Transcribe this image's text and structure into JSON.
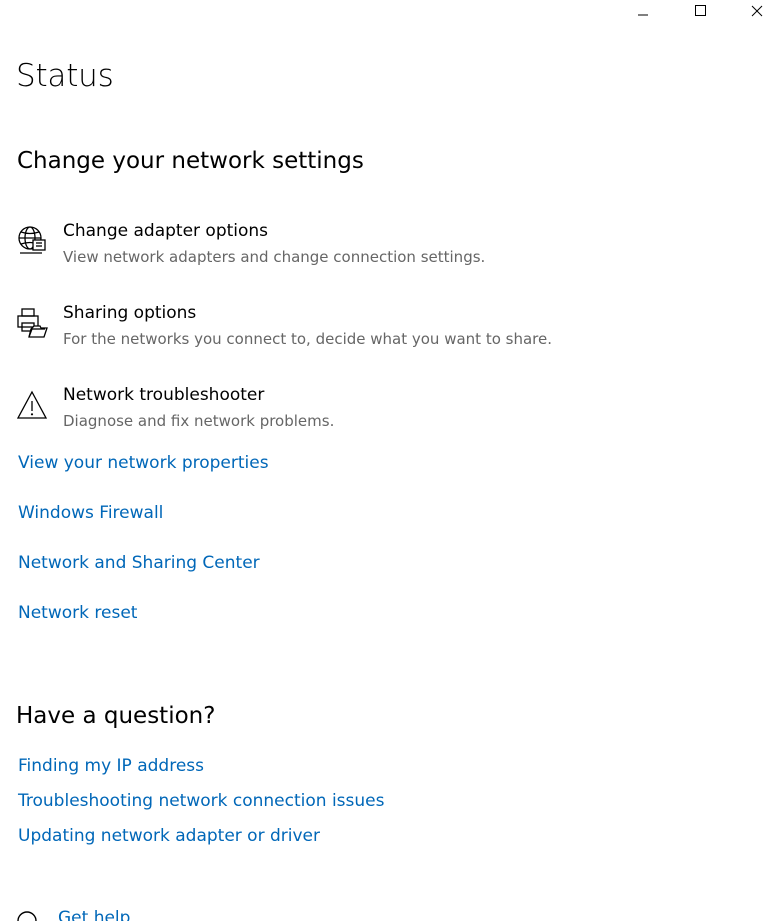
{
  "titlebar": {
    "minimize_icon": "minimize-icon",
    "maximize_icon": "maximize-icon",
    "close_icon": "close-icon"
  },
  "page": {
    "title": "Status"
  },
  "change_settings": {
    "heading": "Change your network settings",
    "options": [
      {
        "icon": "adapter-globe-icon",
        "title": "Change adapter options",
        "description": "View network adapters and change connection settings."
      },
      {
        "icon": "sharing-printer-icon",
        "title": "Sharing options",
        "description": "For the networks you connect to, decide what you want to share."
      },
      {
        "icon": "warning-triangle-icon",
        "title": "Network troubleshooter",
        "description": "Diagnose and fix network problems."
      }
    ],
    "links": [
      "View your network properties",
      "Windows Firewall",
      "Network and Sharing Center",
      "Network reset"
    ]
  },
  "question": {
    "heading": "Have a question?",
    "links": [
      "Finding my IP address",
      "Troubleshooting network connection issues",
      "Updating network adapter or driver"
    ],
    "get_help": {
      "icon": "help-chat-icon",
      "label": "Get help"
    }
  },
  "colors": {
    "link": "#0067b8",
    "description": "#666666",
    "text": "#000000",
    "background": "#ffffff"
  }
}
